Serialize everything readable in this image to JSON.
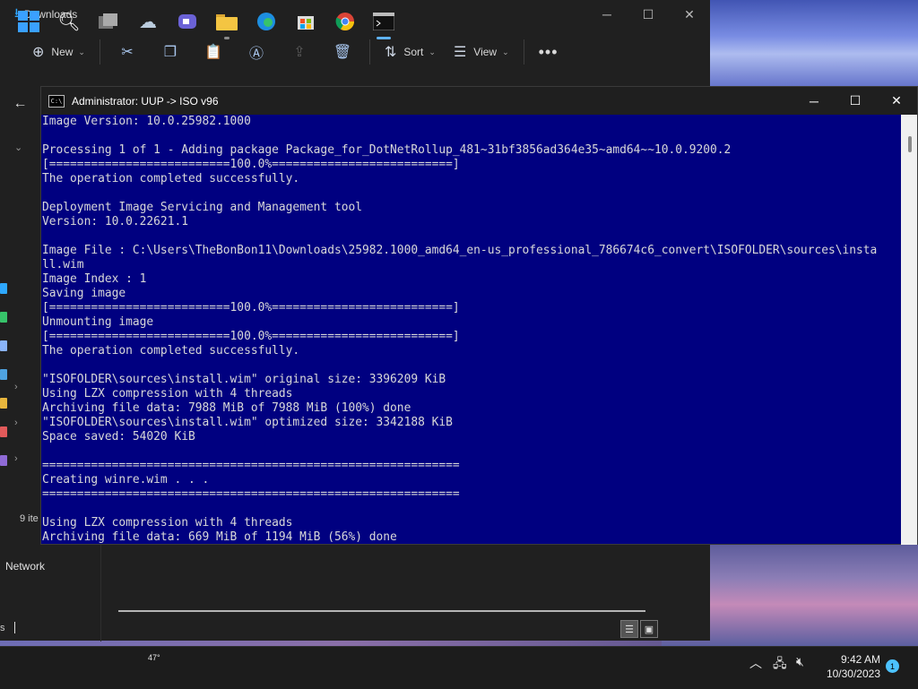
{
  "explorer": {
    "title": "Downloads",
    "toolbar": {
      "new_label": "New",
      "sort_label": "Sort",
      "view_label": "View"
    },
    "status_items": "9 ite",
    "sidebar_network": "Network",
    "status_left": "s"
  },
  "cmd": {
    "title": "Administrator:  UUP -> ISO v96",
    "lines": [
      "Image Version: 10.0.25982.1000",
      "",
      "Processing 1 of 1 - Adding package Package_for_DotNetRollup_481~31bf3856ad364e35~amd64~~10.0.9200.2",
      "[==========================100.0%==========================]",
      "The operation completed successfully.",
      "",
      "Deployment Image Servicing and Management tool",
      "Version: 10.0.22621.1",
      "",
      "Image File : C:\\Users\\TheBonBon11\\Downloads\\25982.1000_amd64_en-us_professional_786674c6_convert\\ISOFOLDER\\sources\\insta",
      "ll.wim",
      "Image Index : 1",
      "Saving image",
      "[==========================100.0%==========================]",
      "Unmounting image",
      "[==========================100.0%==========================]",
      "The operation completed successfully.",
      "",
      "\"ISOFOLDER\\sources\\install.wim\" original size: 3396209 KiB",
      "Using LZX compression with 4 threads",
      "Archiving file data: 7988 MiB of 7988 MiB (100%) done",
      "\"ISOFOLDER\\sources\\install.wim\" optimized size: 3342188 KiB",
      "Space saved: 54020 KiB",
      "",
      "============================================================",
      "Creating winre.wim . . .",
      "============================================================",
      "",
      "Using LZX compression with 4 threads",
      "Archiving file data: 669 MiB of 1194 MiB (56%) done"
    ]
  },
  "taskbar": {
    "weather_temp": "47°",
    "time": "9:42 AM",
    "date": "10/30/2023",
    "notification_count": "1",
    "icons": [
      "windows-start-icon",
      "search-icon",
      "task-view-icon",
      "weather-icon",
      "teams-chat-icon",
      "file-explorer-icon",
      "edge-icon",
      "store-icon",
      "chrome-icon",
      "terminal-icon"
    ]
  },
  "colors": {
    "console_bg": "#000080",
    "console_text": "#d8d8d8",
    "accent": "#2ea8ff"
  }
}
